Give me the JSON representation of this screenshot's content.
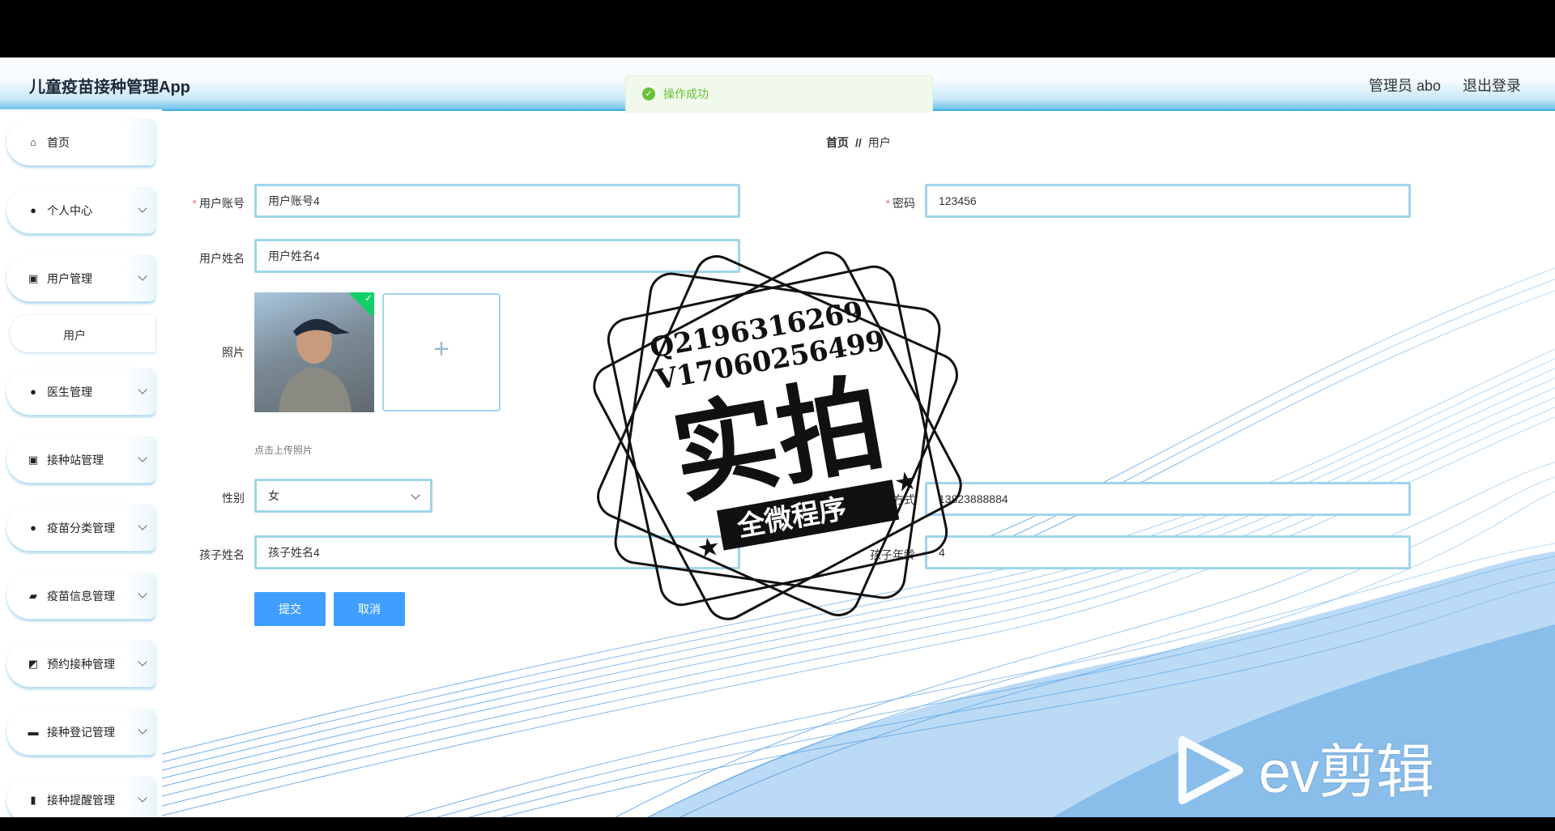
{
  "header": {
    "app_title": "儿童疫苗接种管理App",
    "admin": "管理员 abo",
    "logout": "退出登录"
  },
  "toast": {
    "message": "操作成功"
  },
  "sidebar": {
    "items": [
      {
        "label": "首页",
        "icon": "home-icon"
      },
      {
        "label": "个人中心",
        "icon": "user-icon"
      },
      {
        "label": "用户管理",
        "icon": "clipboard-icon"
      },
      {
        "label": "医生管理",
        "icon": "bulb-icon"
      },
      {
        "label": "接种站管理",
        "icon": "badge-icon"
      },
      {
        "label": "疫苗分类管理",
        "icon": "user-icon"
      },
      {
        "label": "疫苗信息管理",
        "icon": "hand-icon"
      },
      {
        "label": "预约接种管理",
        "icon": "chart-icon"
      },
      {
        "label": "接种登记管理",
        "icon": "monitor-icon"
      },
      {
        "label": "接种提醒管理",
        "icon": "bar-chart-icon"
      }
    ],
    "sub_item": "用户"
  },
  "breadcrumb": {
    "home": "首页",
    "separator": "//",
    "current": "用户"
  },
  "form": {
    "account_label": "用户账号",
    "account_value": "用户账号4",
    "password_label": "密码",
    "password_value": "123456",
    "name_label": "用户姓名",
    "name_value": "用户姓名4",
    "photo_label": "照片",
    "upload_hint": "点击上传照片",
    "gender_label": "性别",
    "gender_value": "女",
    "phone_label_partial": "方式",
    "phone_value": "13823888884",
    "child_name_label": "孩子姓名",
    "child_name_value": "孩子姓名4",
    "child_age_label": "孩子年龄",
    "child_age_value": "4",
    "submit": "提交",
    "cancel": "取消"
  },
  "stamp": {
    "line1": "Q2196316269",
    "line2": "V17060256499",
    "big": "实拍",
    "ribbon": "全微程序"
  },
  "watermark": {
    "text": "ev剪辑"
  }
}
